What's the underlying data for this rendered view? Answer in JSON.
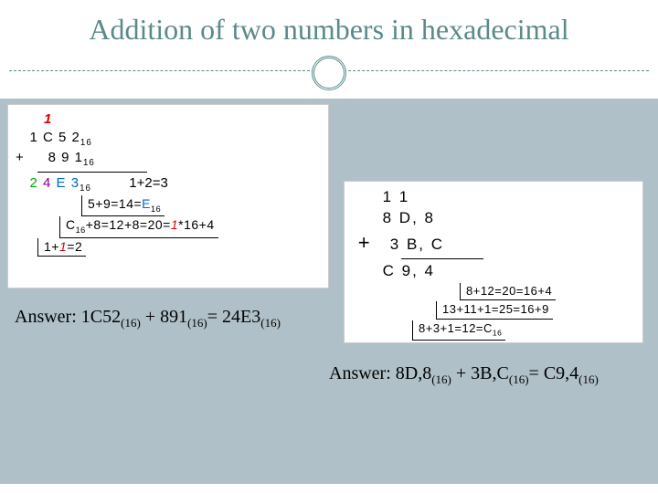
{
  "title": "Addition of two numbers  in hexadecimal",
  "panel1": {
    "carry": "1",
    "operand1": "1 C 5 2",
    "operand1_base": "16",
    "op": "+",
    "operand2": "8 9 1",
    "operand2_base": "16",
    "result_d1": "2",
    "result_d2": "4",
    "result_d3": "E",
    "result_d4": "3",
    "result_base": "16",
    "step1": "1+2=3",
    "step2_a": "5+9=14=",
    "step2_b": "E",
    "step2_base": "16",
    "step3_a": "C",
    "step3_base": "16",
    "step3_b": "+8=12+8=20=",
    "step3_c": "1",
    "step3_d": "*16+4",
    "step4_a": "1+",
    "step4_b": "1",
    "step4_c": "=2"
  },
  "panel2": {
    "carry": "1 1",
    "operand1": "8 D, 8",
    "op": "+",
    "operand2": "3 B, C",
    "result": "C 9, 4",
    "step1": "8+12=20=16+4",
    "step2": "13+11+1=25=16+9",
    "step3_a": "8+3+1=12=C",
    "step3_base": "16"
  },
  "answer1": {
    "label": "Answer: ",
    "a": "1C52",
    "a_base": "(16)",
    "plus": " + ",
    "b": "891",
    "b_base": "(16)",
    "eq": "= ",
    "r": "24E3",
    "r_base": "(16)"
  },
  "answer2": {
    "label": "Answer: ",
    "a": "8D,8",
    "a_base": "(16)",
    "plus": " + ",
    "b": "3B,C",
    "b_base": "(16)",
    "eq": "= ",
    "r": "C9,4",
    "r_base": "(16)"
  }
}
